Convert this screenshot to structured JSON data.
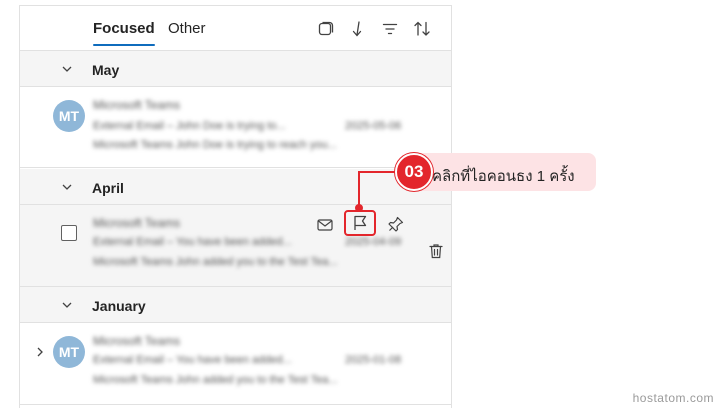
{
  "tabs": {
    "focused": "Focused",
    "other": "Other"
  },
  "toolbar": {
    "icons": [
      "select-mode-icon",
      "jump-down-icon",
      "filter-icon",
      "sort-icon"
    ]
  },
  "groups": [
    {
      "label": "May"
    },
    {
      "label": "April"
    },
    {
      "label": "January"
    }
  ],
  "messages": [
    {
      "avatar": "MT",
      "sender": "Microsoft Teams",
      "subject": "External Email – John Doe is trying to...",
      "date": "2025-05-06",
      "preview": "Microsoft Teams John Doe is trying to reach you..."
    },
    {
      "avatar": "",
      "sender": "Microsoft Teams",
      "subject": "External Email – You have been added...",
      "date": "2025-04-09",
      "preview": "Microsoft Teams John added you to the Test Tea..."
    },
    {
      "avatar": "MT",
      "sender": "Microsoft Teams",
      "subject": "External Email – You have been added...",
      "date": "2025-01-08",
      "preview": "Microsoft Teams John added you to the Test Tea..."
    }
  ],
  "callout": {
    "step": "03",
    "text": "คลิกที่ไอคอนธง 1 ครั้ง",
    "color": "#e3262c"
  },
  "watermark": "hostatom.com"
}
